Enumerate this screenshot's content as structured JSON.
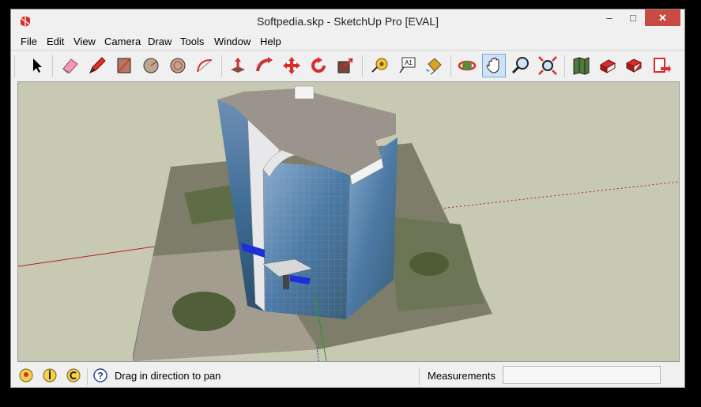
{
  "window": {
    "title": "Softpedia.skp - SketchUp Pro [EVAL]"
  },
  "window_controls": {
    "minimize": "–",
    "maximize": "□",
    "close": "✕"
  },
  "menu": [
    "File",
    "Edit",
    "View",
    "Camera",
    "Draw",
    "Tools",
    "Window",
    "Help"
  ],
  "toolbar": {
    "icons": [
      "select-icon",
      "eraser-icon",
      "pencil-icon",
      "rectangle-icon",
      "circle-icon",
      "polygon-icon",
      "arc-icon",
      "push-pull-icon",
      "follow-me-icon",
      "move-icon",
      "rotate-icon",
      "scale-icon",
      "tape-measure-icon",
      "text-label-icon",
      "paint-bucket-icon",
      "orbit-icon",
      "pan-icon",
      "zoom-icon",
      "zoom-extents-icon",
      "get-models-icon",
      "share-model-icon",
      "share-component-icon",
      "send-to-layout-icon"
    ],
    "text_label_glyph": "A1",
    "active": "pan-icon"
  },
  "status": {
    "message": "Drag in direction to pan",
    "measurements_label": "Measurements",
    "measurements_value": ""
  },
  "colors": {
    "red_axis": "#b02020",
    "green_axis": "#20a020",
    "blue_axis": "#2030c0",
    "background": "#c8c9b2",
    "accent_active": "#cfe3f7"
  }
}
